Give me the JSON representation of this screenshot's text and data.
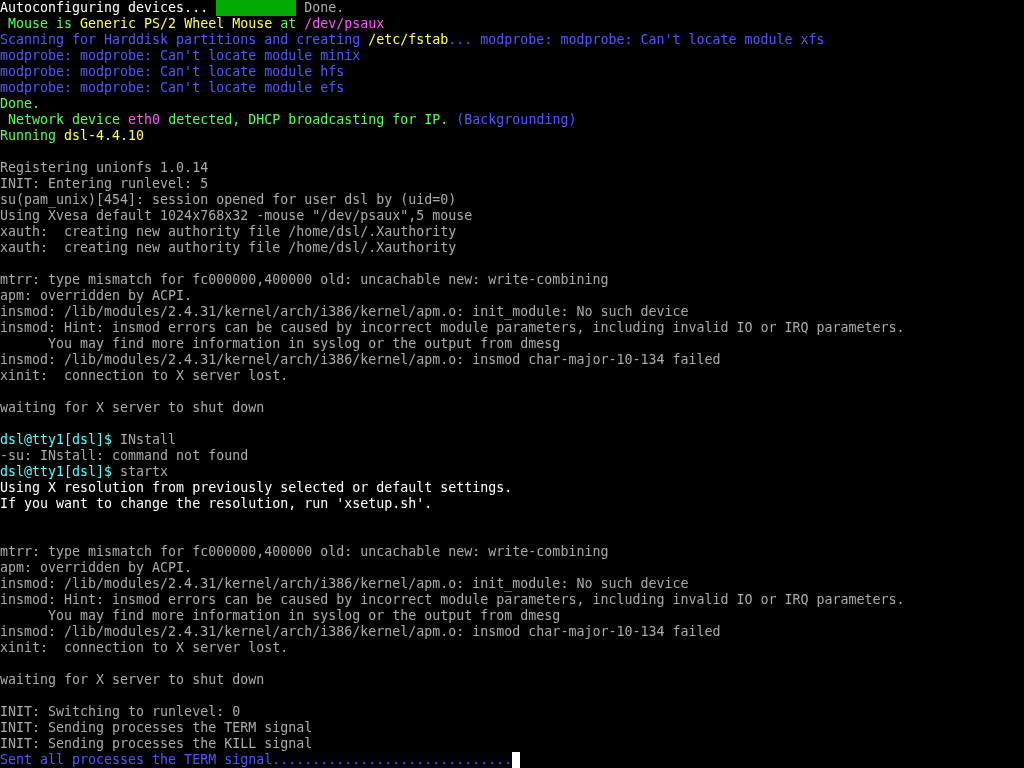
{
  "console": {
    "lines": [
      {
        "kind": "text",
        "segments": [
          {
            "kind": "text",
            "text": "Autoconfiguring devices... ",
            "color": "#ffffff"
          },
          {
            "kind": "block",
            "color": "#00aa00"
          },
          {
            "kind": "text",
            "text": " Done.",
            "color": "#aaaaaa"
          }
        ]
      },
      {
        "kind": "text",
        "segments": [
          {
            "kind": "text",
            "text": " Mouse is ",
            "color": "#55ff55"
          },
          {
            "kind": "text",
            "text": "Generic PS/2 Wheel Mouse",
            "color": "#ffff55"
          },
          {
            "kind": "text",
            "text": " at ",
            "color": "#55ff55"
          },
          {
            "kind": "text",
            "text": "/dev/psaux",
            "color": "#ff55ff"
          }
        ]
      },
      {
        "kind": "text",
        "segments": [
          {
            "kind": "text",
            "text": "Scanning for Harddisk partitions and creating ",
            "color": "#5555ff"
          },
          {
            "kind": "text",
            "text": "/etc/fstab",
            "color": "#ffff55"
          },
          {
            "kind": "text",
            "text": "... modprobe: modprobe: Can't locate module xfs",
            "color": "#5555ff"
          }
        ]
      },
      {
        "kind": "text",
        "segments": [
          {
            "kind": "text",
            "text": "modprobe: modprobe: Can't locate module minix",
            "color": "#5555ff"
          }
        ]
      },
      {
        "kind": "text",
        "segments": [
          {
            "kind": "text",
            "text": "modprobe: modprobe: Can't locate module hfs",
            "color": "#5555ff"
          }
        ]
      },
      {
        "kind": "text",
        "segments": [
          {
            "kind": "text",
            "text": "modprobe: modprobe: Can't locate module efs",
            "color": "#5555ff"
          }
        ]
      },
      {
        "kind": "text",
        "segments": [
          {
            "kind": "text",
            "text": "Done.",
            "color": "#55ff55"
          }
        ]
      },
      {
        "kind": "text",
        "segments": [
          {
            "kind": "text",
            "text": " Network device ",
            "color": "#55ff55"
          },
          {
            "kind": "text",
            "text": "eth0",
            "color": "#ff55ff"
          },
          {
            "kind": "text",
            "text": " detected, DHCP broadcasting for IP. ",
            "color": "#55ff55"
          },
          {
            "kind": "text",
            "text": "(Backgrounding)",
            "color": "#5555ff"
          }
        ]
      },
      {
        "kind": "text",
        "segments": [
          {
            "kind": "text",
            "text": "Running ",
            "color": "#55ff55"
          },
          {
            "kind": "text",
            "text": "dsl-4.4.10",
            "color": "#ffff55"
          }
        ]
      },
      {
        "kind": "blank"
      },
      {
        "kind": "text",
        "segments": [
          {
            "kind": "text",
            "text": "Registering unionfs 1.0.14",
            "color": "#aaaaaa"
          }
        ]
      },
      {
        "kind": "text",
        "segments": [
          {
            "kind": "text",
            "text": "INIT: Entering runlevel: 5",
            "color": "#aaaaaa"
          }
        ]
      },
      {
        "kind": "text",
        "segments": [
          {
            "kind": "text",
            "text": "su(pam_unix)[454]: session opened for user dsl by (uid=0)",
            "color": "#aaaaaa"
          }
        ]
      },
      {
        "kind": "text",
        "segments": [
          {
            "kind": "text",
            "text": "Using Xvesa default 1024x768x32 -mouse \"/dev/psaux\",5 mouse",
            "color": "#aaaaaa"
          }
        ]
      },
      {
        "kind": "text",
        "segments": [
          {
            "kind": "text",
            "text": "xauth:  creating new authority file /home/dsl/.Xauthority",
            "color": "#aaaaaa"
          }
        ]
      },
      {
        "kind": "text",
        "segments": [
          {
            "kind": "text",
            "text": "xauth:  creating new authority file /home/dsl/.Xauthority",
            "color": "#aaaaaa"
          }
        ]
      },
      {
        "kind": "blank"
      },
      {
        "kind": "text",
        "segments": [
          {
            "kind": "text",
            "text": "mtrr: type mismatch for fc000000,400000 old: uncachable new: write-combining",
            "color": "#aaaaaa"
          }
        ]
      },
      {
        "kind": "text",
        "segments": [
          {
            "kind": "text",
            "text": "apm: overridden by ACPI.",
            "color": "#aaaaaa"
          }
        ]
      },
      {
        "kind": "text",
        "segments": [
          {
            "kind": "text",
            "text": "insmod: /lib/modules/2.4.31/kernel/arch/i386/kernel/apm.o: init_module: No such device",
            "color": "#aaaaaa"
          }
        ]
      },
      {
        "kind": "text",
        "segments": [
          {
            "kind": "text",
            "text": "insmod: Hint: insmod errors can be caused by incorrect module parameters, including invalid IO or IRQ parameters.",
            "color": "#aaaaaa"
          }
        ]
      },
      {
        "kind": "text",
        "segments": [
          {
            "kind": "text",
            "text": "      You may find more information in syslog or the output from dmesg",
            "color": "#aaaaaa"
          }
        ]
      },
      {
        "kind": "text",
        "segments": [
          {
            "kind": "text",
            "text": "insmod: /lib/modules/2.4.31/kernel/arch/i386/kernel/apm.o: insmod char-major-10-134 failed",
            "color": "#aaaaaa"
          }
        ]
      },
      {
        "kind": "text",
        "segments": [
          {
            "kind": "text",
            "text": "xinit:  connection to X server lost.",
            "color": "#aaaaaa"
          }
        ]
      },
      {
        "kind": "blank"
      },
      {
        "kind": "text",
        "segments": [
          {
            "kind": "text",
            "text": "waiting for X server to shut down",
            "color": "#aaaaaa"
          }
        ]
      },
      {
        "kind": "blank"
      },
      {
        "kind": "text",
        "segments": [
          {
            "kind": "text",
            "text": "dsl@tty1[dsl]$",
            "color": "#55ffff"
          },
          {
            "kind": "text",
            "text": " INstall",
            "color": "#aaaaaa"
          }
        ]
      },
      {
        "kind": "text",
        "segments": [
          {
            "kind": "text",
            "text": "-su: INstall: command not found",
            "color": "#aaaaaa"
          }
        ]
      },
      {
        "kind": "text",
        "segments": [
          {
            "kind": "text",
            "text": "dsl@tty1[dsl]$",
            "color": "#55ffff"
          },
          {
            "kind": "text",
            "text": " startx",
            "color": "#aaaaaa"
          }
        ]
      },
      {
        "kind": "text",
        "segments": [
          {
            "kind": "text",
            "text": "Using X resolution from previously selected or default settings.",
            "color": "#ffffff"
          }
        ]
      },
      {
        "kind": "text",
        "segments": [
          {
            "kind": "text",
            "text": "If you want to change the resolution, run 'xsetup.sh'.",
            "color": "#ffffff"
          }
        ]
      },
      {
        "kind": "blank"
      },
      {
        "kind": "blank"
      },
      {
        "kind": "text",
        "segments": [
          {
            "kind": "text",
            "text": "mtrr: type mismatch for fc000000,400000 old: uncachable new: write-combining",
            "color": "#aaaaaa"
          }
        ]
      },
      {
        "kind": "text",
        "segments": [
          {
            "kind": "text",
            "text": "apm: overridden by ACPI.",
            "color": "#aaaaaa"
          }
        ]
      },
      {
        "kind": "text",
        "segments": [
          {
            "kind": "text",
            "text": "insmod: /lib/modules/2.4.31/kernel/arch/i386/kernel/apm.o: init_module: No such device",
            "color": "#aaaaaa"
          }
        ]
      },
      {
        "kind": "text",
        "segments": [
          {
            "kind": "text",
            "text": "insmod: Hint: insmod errors can be caused by incorrect module parameters, including invalid IO or IRQ parameters.",
            "color": "#aaaaaa"
          }
        ]
      },
      {
        "kind": "text",
        "segments": [
          {
            "kind": "text",
            "text": "      You may find more information in syslog or the output from dmesg",
            "color": "#aaaaaa"
          }
        ]
      },
      {
        "kind": "text",
        "segments": [
          {
            "kind": "text",
            "text": "insmod: /lib/modules/2.4.31/kernel/arch/i386/kernel/apm.o: insmod char-major-10-134 failed",
            "color": "#aaaaaa"
          }
        ]
      },
      {
        "kind": "text",
        "segments": [
          {
            "kind": "text",
            "text": "xinit:  connection to X server lost.",
            "color": "#aaaaaa"
          }
        ]
      },
      {
        "kind": "blank"
      },
      {
        "kind": "text",
        "segments": [
          {
            "kind": "text",
            "text": "waiting for X server to shut down",
            "color": "#aaaaaa"
          }
        ]
      },
      {
        "kind": "blank"
      },
      {
        "kind": "text",
        "segments": [
          {
            "kind": "text",
            "text": "INIT: Switching to runlevel: 0",
            "color": "#aaaaaa"
          }
        ]
      },
      {
        "kind": "text",
        "segments": [
          {
            "kind": "text",
            "text": "INIT: Sending processes the TERM signal",
            "color": "#aaaaaa"
          }
        ]
      },
      {
        "kind": "text",
        "segments": [
          {
            "kind": "text",
            "text": "INIT: Sending processes the KILL signal",
            "color": "#aaaaaa"
          }
        ]
      },
      {
        "kind": "text",
        "segments": [
          {
            "kind": "text",
            "text": "Sent all processes the TERM signal..............................",
            "color": "#5555ff"
          },
          {
            "kind": "cursor",
            "color": "#ffffff"
          }
        ]
      }
    ]
  }
}
